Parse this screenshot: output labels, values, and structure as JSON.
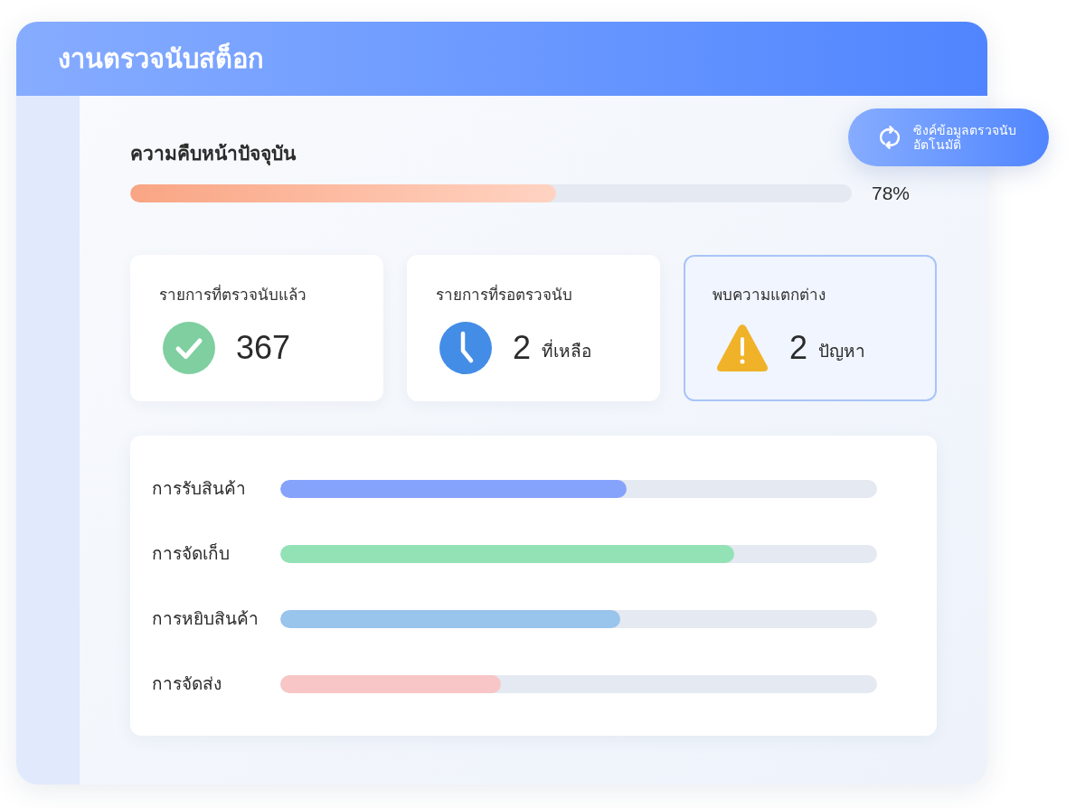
{
  "window": {
    "title": "งานตรวจนับสต็อก"
  },
  "sync_button": {
    "label": "ซิงค์ข้อมูลตรวจนับ อัตโนมัติ"
  },
  "progress": {
    "heading": "ความคืบหน้าปัจจุบัน",
    "level": 0.59,
    "reading": "78%"
  },
  "stat_cards": [
    {
      "kind": "done",
      "label": "รายการที่ตรวจนับแล้ว",
      "value": "367",
      "selected": false
    },
    {
      "kind": "pending",
      "label": "รายการที่รอตรวจนับ",
      "value": "2",
      "unit": "ที่เหลือ",
      "selected": false
    },
    {
      "kind": "issue",
      "label": "พบความแตกต่าง",
      "value": "2",
      "unit": "ปัญหา",
      "selected": true
    }
  ],
  "stages": [
    {
      "name": "การรับสินค้า",
      "level": 0.58,
      "color": "#86a3fb"
    },
    {
      "name": "การจัดเก็บ",
      "level": 0.76,
      "color": "#93e2b6"
    },
    {
      "name": "การหยิบสินค้า",
      "level": 0.57,
      "color": "#99c4ec"
    },
    {
      "name": "การจัดส่ง",
      "level": 0.37,
      "color": "#f8c6c6"
    }
  ]
}
